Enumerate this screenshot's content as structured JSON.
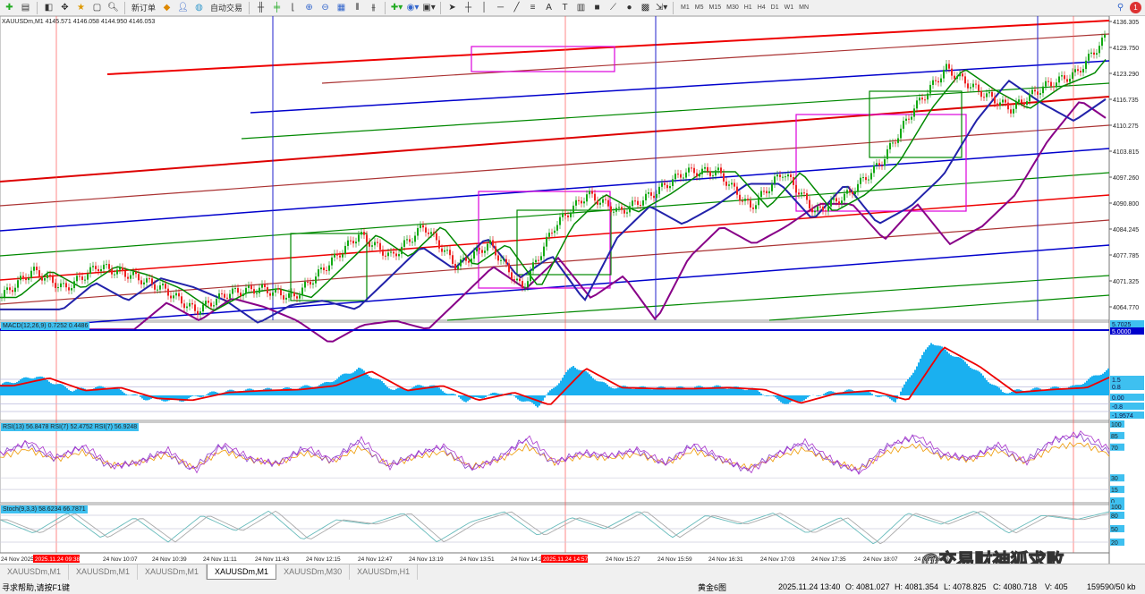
{
  "toolbar": {
    "new_order": "新订单",
    "auto_trade": "自动交易",
    "timeframes": [
      "M1",
      "M5",
      "M15",
      "M30",
      "H1",
      "H4",
      "D1",
      "W1",
      "MN"
    ],
    "notification_count": "1"
  },
  "chart": {
    "info": "XAUUSDm,M1  4145.571 4146.058 4144.950 4146.053",
    "price_ticks": [
      "4136.305",
      "4129.750",
      "4123.290",
      "4116.735",
      "4110.275",
      "4103.815",
      "4097.260",
      "4090.800",
      "4084.245",
      "4077.785",
      "4071.325",
      "4064.770"
    ],
    "time_labels": [
      "24 Nov 2025",
      "24 Nov 10:07",
      "24 Nov 10:39",
      "24 Nov 11:11",
      "24 Nov 11:43",
      "24 Nov 12:15",
      "24 Nov 12:47",
      "24 Nov 13:19",
      "24 Nov 13:51",
      "24 Nov 14:25",
      "24 Nov 15:27",
      "24 Nov 15:59",
      "24 Nov 16:31",
      "24 Nov 17:03",
      "24 Nov 17:35",
      "24 Nov 18:07",
      "24 Nov 18:39"
    ],
    "highlight_times": [
      "2025.11.24 09:38",
      "2025.11.24 14:57"
    ]
  },
  "chart_data": {
    "type": "line",
    "title": "XAUUSDm,M1",
    "ylim": [
      4062,
      4138
    ],
    "close": [
      4067.7,
      4074.4,
      4069.9,
      4075.5,
      4073.3,
      4069.9,
      4064.3,
      4068.8,
      4069.9,
      4067.7,
      4075.5,
      4083.4,
      4077.8,
      4085.6,
      4075.5,
      4081.1,
      4069.9,
      4085.6,
      4093.5,
      4089.0,
      4093.5,
      4099.1,
      4099.1,
      4090.1,
      4099.1,
      4089.0,
      4093.5,
      4101.3,
      4114.8,
      4124.9,
      4119.3,
      4114.8,
      4120.4,
      4123.7,
      4133.8
    ]
  },
  "macd": {
    "label": "MACD(12,26,9) 0.7252 0.4486",
    "ticks": [
      "5.7025",
      "5.0000",
      "1.5",
      "0.8",
      "0.00",
      "-0.8",
      "-1.9574"
    ],
    "values": [
      1.0,
      1.8,
      0.5,
      0.8,
      -0.3,
      -0.5,
      0.3,
      0.5,
      0.6,
      1.0,
      2.5,
      0.5,
      1.0,
      -0.5,
      0.3,
      -1.0,
      2.8,
      0.8,
      0.7,
      0.7,
      0.8,
      0.6,
      -0.8,
      0.2,
      0.5,
      -0.5,
      5.0,
      3.0,
      0.3,
      0.6,
      0.8,
      2.5
    ]
  },
  "rsi": {
    "label": "RSI(13) 56.8478  RSI(7) 52.4752  RSI(7) 56.9248",
    "ticks": [
      "100",
      "85",
      "70",
      "30",
      "15",
      "0"
    ],
    "values": [
      60,
      75,
      55,
      70,
      45,
      50,
      65,
      40,
      72,
      55,
      48,
      68,
      52,
      78,
      45,
      60,
      70,
      42,
      55,
      80,
      50,
      62,
      58,
      66,
      48,
      72,
      55,
      40,
      60,
      75,
      52,
      38,
      70,
      82,
      60,
      55,
      72,
      50,
      78,
      85,
      65
    ]
  },
  "stoch": {
    "label": "Stoch(9,3,3) 58.6234 66.7871",
    "ticks": [
      "100",
      "80",
      "50",
      "20"
    ],
    "values": [
      70,
      40,
      85,
      30,
      75,
      20,
      80,
      45,
      90,
      25,
      70,
      60,
      85,
      20,
      65,
      88,
      35,
      75,
      50,
      90,
      30,
      80,
      60,
      85,
      40,
      75,
      15,
      85,
      60,
      90,
      40,
      80,
      70,
      88
    ]
  },
  "tabs": [
    "XAUUSDm,M1",
    "XAUUSDm,M1",
    "XAUUSDm,M1",
    "XAUUSDm,M1",
    "XAUUSDm,M30",
    "XAUUSDm,H1"
  ],
  "status": {
    "help": "寻求帮助,请按F1键",
    "profile": "黄金6图",
    "datetime": "2025.11.24 13:40",
    "open": "O: 4081.027",
    "high": "H: 4081.354",
    "low": "L: 4078.825",
    "close": "C: 4080.718",
    "volume": "V: 405",
    "traffic": "159590/50 kb"
  },
  "watermark": "@交易财神狐求败"
}
